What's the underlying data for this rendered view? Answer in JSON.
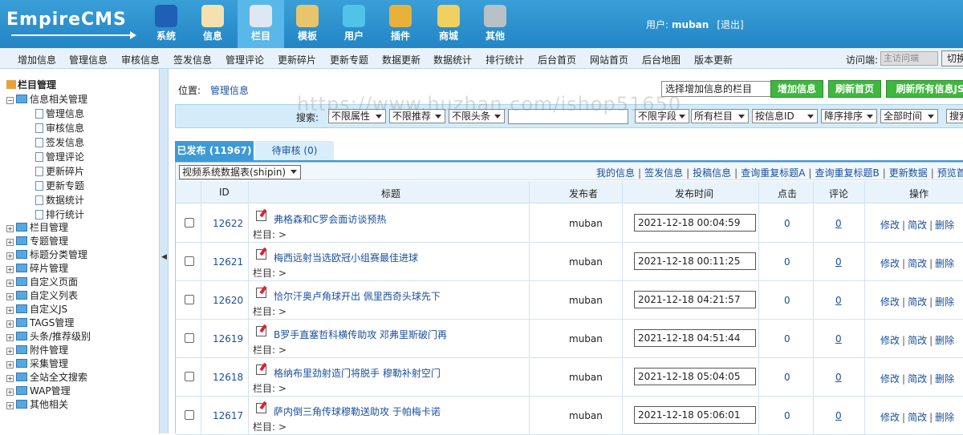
{
  "brand": {
    "logo_text": "EmpireCMS"
  },
  "topnav": [
    {
      "label": "系统",
      "color": "#1f5fb4",
      "active": false
    },
    {
      "label": "信息",
      "color": "#f3e2b0",
      "active": false
    },
    {
      "label": "栏目",
      "color": "#dfe8f2",
      "active": true
    },
    {
      "label": "模板",
      "color": "#e8c46a",
      "active": false
    },
    {
      "label": "用户",
      "color": "#4fc3e8",
      "active": false
    },
    {
      "label": "插件",
      "color": "#e8b23a",
      "active": false
    },
    {
      "label": "商城",
      "color": "#f0d060",
      "active": false
    },
    {
      "label": "其他",
      "color": "#b8c0c8",
      "active": false
    }
  ],
  "user": {
    "prefix": "用户:",
    "name": "muban",
    "logout": "[退出]"
  },
  "subnav": [
    "增加信息",
    "管理信息",
    "审核信息",
    "签发信息",
    "管理评论",
    "更新碎片",
    "更新专题",
    "数据更新",
    "数据统计",
    "排行统计",
    "后台首页",
    "网站首页",
    "后台地图",
    "版本更新"
  ],
  "visit": {
    "label": "访问端:",
    "selected": "主访问端",
    "switch_label": "切换"
  },
  "sidebar": {
    "root": "栏目管理",
    "info_group": "信息相关管理",
    "info_items": [
      "管理信息",
      "审核信息",
      "签发信息",
      "管理评论",
      "更新碎片",
      "更新专题",
      "数据统计",
      "排行统计"
    ],
    "groups": [
      "栏目管理",
      "专题管理",
      "标题分类管理",
      "碎片管理",
      "自定义页面",
      "自定义列表",
      "自定义JS",
      "TAGS管理",
      "头条/推荐级别",
      "附件管理",
      "采集管理",
      "全站全文搜索",
      "WAP管理",
      "其他相关"
    ]
  },
  "main": {
    "position_label": "位置:",
    "position_value": "管理信息",
    "category_select": "选择增加信息的栏目",
    "btn_add": "增加信息",
    "btn_refresh_home": "刷新首页",
    "btn_refresh_all": "刷新所有信息JS",
    "search": {
      "label": "搜索:",
      "selects": [
        "不限属性",
        "不限推荐",
        "不限头条",
        "不限字段",
        "所有栏目",
        "按信息ID",
        "降序排序",
        "全部时间"
      ],
      "button": "搜索"
    },
    "tabs": [
      "已发布 (11967)",
      "待审核 (0)"
    ],
    "table_select": "视频系统数据表(shipin)",
    "tool_links": [
      "我的信息",
      "签发信息",
      "投稿信息",
      "查询重复标题A",
      "查询重复标题B",
      "更新数据",
      "预览首页"
    ],
    "columns": [
      "ID",
      "标题",
      "发布者",
      "发布时间",
      "点击",
      "评论",
      "操作"
    ],
    "lanmu_label": "栏目: >",
    "ops": [
      "修改",
      "简改",
      "删除"
    ],
    "rows": [
      {
        "id": "12622",
        "title": "弗格森和C罗会面访谈预热",
        "publisher": "muban",
        "time": "2021-12-18 00:04:59",
        "hits": "0",
        "comments": "0"
      },
      {
        "id": "12621",
        "title": "梅西远射当选欧冠小组赛最佳进球",
        "publisher": "muban",
        "time": "2021-12-18 00:11:25",
        "hits": "0",
        "comments": "0"
      },
      {
        "id": "12620",
        "title": "恰尔汗奥卢角球开出 佩里西奇头球先下",
        "publisher": "muban",
        "time": "2021-12-18 04:21:57",
        "hits": "0",
        "comments": "0"
      },
      {
        "id": "12619",
        "title": "B罗手直塞哲科横传助攻 邓弗里斯破门再",
        "publisher": "muban",
        "time": "2021-12-18 04:51:44",
        "hits": "0",
        "comments": "0"
      },
      {
        "id": "12618",
        "title": "格纳布里劲射造门将脱手 穆勒补射空门",
        "publisher": "muban",
        "time": "2021-12-18 05:04:05",
        "hits": "0",
        "comments": "0"
      },
      {
        "id": "12617",
        "title": "萨内倒三角传球穆勒送助攻 于帕梅卡诺",
        "publisher": "muban",
        "time": "2021-12-18 05:06:01",
        "hits": "0",
        "comments": "0"
      }
    ]
  },
  "watermark": "https://www.huzhan.com/ishop51650"
}
